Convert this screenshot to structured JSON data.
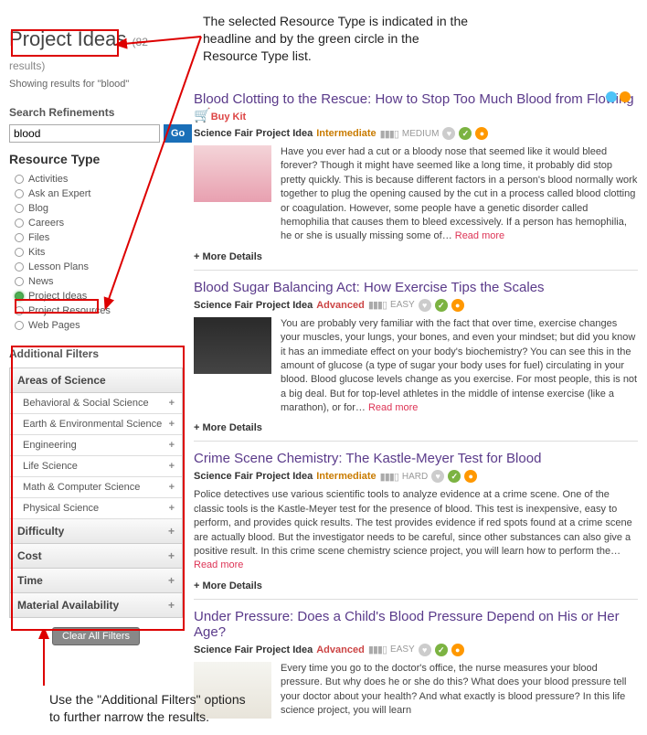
{
  "annotations": {
    "top_text_line1": "The selected Resource Type is indicated in the",
    "top_text_line2": "headline and by the green circle in the",
    "top_text_line3": "Resource Type list.",
    "bottom_text_line1": "Use the \"Additional Filters\" options",
    "bottom_text_line2": "to further narrow the results."
  },
  "header": {
    "title": "Project Ideas",
    "results_count": "(82 results)",
    "showing": "Showing results for \"blood\""
  },
  "search": {
    "refinements_label": "Search Refinements",
    "value": "blood",
    "go_label": "Go"
  },
  "resource_type": {
    "heading": "Resource Type",
    "items": [
      {
        "label": "Activities",
        "selected": false
      },
      {
        "label": "Ask an Expert",
        "selected": false
      },
      {
        "label": "Blog",
        "selected": false
      },
      {
        "label": "Careers",
        "selected": false
      },
      {
        "label": "Files",
        "selected": false
      },
      {
        "label": "Kits",
        "selected": false
      },
      {
        "label": "Lesson Plans",
        "selected": false
      },
      {
        "label": "News",
        "selected": false
      },
      {
        "label": "Project Ideas",
        "selected": true
      },
      {
        "label": "Project Resources",
        "selected": false
      },
      {
        "label": "Web Pages",
        "selected": false
      }
    ]
  },
  "filters": {
    "heading": "Additional Filters",
    "areas_label": "Areas of Science",
    "areas": [
      "Behavioral & Social Science",
      "Earth & Environmental Science",
      "Engineering",
      "Life Science",
      "Math & Computer Science",
      "Physical Science"
    ],
    "groups": [
      "Difficulty",
      "Cost",
      "Time",
      "Material Availability"
    ],
    "clear_label": "Clear All Filters"
  },
  "results": [
    {
      "title": "Blood Clotting to the Rescue: How to Stop Too Much Blood from Flowing",
      "buy_kit": "Buy Kit",
      "type": "Science Fair Project Idea",
      "difficulty_label": "Intermediate",
      "difficulty_class": "diff-intermediate",
      "level_label": "MEDIUM",
      "thumb_class": "thumb-pink",
      "desc": "Have you ever had a cut or a bloody nose that seemed like it would bleed forever? Though it might have seemed like a long time, it probably did stop pretty quickly. This is because different factors in a person's blood normally work together to plug the opening caused by the cut in a process called blood clotting or coagulation. However, some people have a genetic disorder called hemophilia that causes them to bleed excessively. If a person has hemophilia, he or she is usually missing some of…",
      "read_more": "Read more",
      "more_details": "+ More Details"
    },
    {
      "title": "Blood Sugar Balancing Act: How Exercise Tips the Scales",
      "type": "Science Fair Project Idea",
      "difficulty_label": "Advanced",
      "difficulty_class": "diff-advanced",
      "level_label": "EASY",
      "thumb_class": "thumb-dark",
      "desc": "You are probably very familiar with the fact that over time, exercise changes your muscles, your lungs, your bones, and even your mindset; but did you know it has an immediate effect on your body's biochemistry? You can see this in the amount of glucose (a type of sugar your body uses for fuel) circulating in your blood. Blood glucose levels change as you exercise. For most people, this is not a big deal. But for top-level athletes in the middle of intense exercise (like a marathon), or for…",
      "read_more": "Read more",
      "more_details": "+ More Details"
    },
    {
      "title": "Crime Scene Chemistry: The Kastle-Meyer Test for Blood",
      "type": "Science Fair Project Idea",
      "difficulty_label": "Intermediate",
      "difficulty_class": "diff-intermediate",
      "level_label": "HARD",
      "desc": "Police detectives use various scientific tools to analyze evidence at a crime scene. One of the classic tools is the Kastle-Meyer test for the presence of blood. This test is inexpensive, easy to perform, and provides quick results. The test provides evidence if red spots found at a crime scene are actually blood. But the investigator needs to be careful, since other substances can also give a positive result. In this crime scene chemistry science project, you will learn how to perform the…",
      "read_more": "Read more",
      "more_details": "+ More Details"
    },
    {
      "title": "Under Pressure: Does a Child's Blood Pressure Depend on His or Her Age?",
      "type": "Science Fair Project Idea",
      "difficulty_label": "Advanced",
      "difficulty_class": "diff-advanced",
      "level_label": "EASY",
      "thumb_class": "thumb-paper",
      "desc": "Every time you go to the doctor's office, the nurse measures your blood pressure. But why does he or she do this? What does your blood pressure tell your doctor about your health? And what exactly is blood pressure? In this life science project, you will learn"
    }
  ]
}
